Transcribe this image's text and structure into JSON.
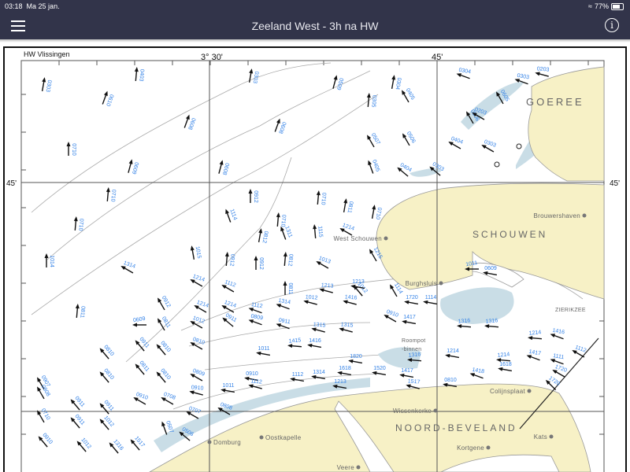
{
  "status_bar": {
    "time": "03:18",
    "date": "Ma 25 jan.",
    "battery": "77%",
    "battery_level": 0.77
  },
  "nav": {
    "title": "Zeeland West - 3h na HW",
    "menu_icon": "hamburger-icon",
    "info_icon": "info-icon",
    "info_glyph": "i"
  },
  "chart": {
    "reference": "HW  Vlissingen",
    "lon_labels": [
      "3° 30'",
      "45'"
    ],
    "lat_labels": [
      "45'",
      "45'"
    ],
    "places": [
      {
        "name": "GOEREE",
        "type": "region"
      },
      {
        "name": "Brouwershaven",
        "type": "town"
      },
      {
        "name": "West Schouwen",
        "type": "town"
      },
      {
        "name": "SCHOUWEN",
        "type": "region"
      },
      {
        "name": "Burghsluis",
        "type": "town"
      },
      {
        "name": "ZIERIKZEE",
        "type": "town"
      },
      {
        "name": "Roompot",
        "type": "label"
      },
      {
        "name": "-binnen",
        "type": "label"
      },
      {
        "name": "Colijnsplaat",
        "type": "town"
      },
      {
        "name": "Wissenkerke",
        "type": "town"
      },
      {
        "name": "NOORD-BEVELAND",
        "type": "region"
      },
      {
        "name": "Kats",
        "type": "town"
      },
      {
        "name": "Kortgene",
        "type": "town"
      },
      {
        "name": "Domburg",
        "type": "town"
      },
      {
        "name": "Oostkapelle",
        "type": "town"
      },
      {
        "name": "Veere",
        "type": "town"
      }
    ],
    "currents": [
      {
        "label": "0303",
        "bearing": 10
      },
      {
        "label": "0403",
        "bearing": 5
      },
      {
        "label": "0303",
        "bearing": 10
      },
      {
        "label": "0610",
        "bearing": 20
      },
      {
        "label": "0509",
        "bearing": 15
      },
      {
        "label": "0305",
        "bearing": 5
      },
      {
        "label": "0304",
        "bearing": 10
      },
      {
        "label": "0304",
        "bearing": 290
      },
      {
        "label": "0303",
        "bearing": 290
      },
      {
        "label": "0203",
        "bearing": 285
      },
      {
        "label": "0405",
        "bearing": 330
      },
      {
        "label": "0605",
        "bearing": 330
      },
      {
        "label": "0506",
        "bearing": 330
      },
      {
        "label": "0203",
        "bearing": 300
      },
      {
        "label": "0710",
        "bearing": 0
      },
      {
        "label": "0609",
        "bearing": 15
      },
      {
        "label": "0608",
        "bearing": 20
      },
      {
        "label": "0608",
        "bearing": 20
      },
      {
        "label": "0507",
        "bearing": 330
      },
      {
        "label": "0506",
        "bearing": 330
      },
      {
        "label": "0404",
        "bearing": 300
      },
      {
        "label": "0303",
        "bearing": 300
      },
      {
        "label": "0710",
        "bearing": 5
      },
      {
        "label": "0608",
        "bearing": 15
      },
      {
        "label": "0405",
        "bearing": 340
      },
      {
        "label": "0404",
        "bearing": 310
      },
      {
        "label": "0303",
        "bearing": 310
      },
      {
        "label": "0710",
        "bearing": 5
      },
      {
        "label": "1114",
        "bearing": 340
      },
      {
        "label": "0912",
        "bearing": 0
      },
      {
        "label": "0710",
        "bearing": 5
      },
      {
        "label": "0811",
        "bearing": 10
      },
      {
        "label": "0710",
        "bearing": 10
      },
      {
        "label": "0812",
        "bearing": 10
      },
      {
        "label": "0710",
        "bearing": 5
      },
      {
        "label": "1311",
        "bearing": 340
      },
      {
        "label": "1115",
        "bearing": 355
      },
      {
        "label": "1015",
        "bearing": 350
      },
      {
        "label": "0912",
        "bearing": 5
      },
      {
        "label": "0912",
        "bearing": 0
      },
      {
        "label": "0812",
        "bearing": 5
      },
      {
        "label": "1013",
        "bearing": 300
      },
      {
        "label": "1214",
        "bearing": 300
      },
      {
        "label": "1215",
        "bearing": 330
      },
      {
        "label": "1114",
        "bearing": 330
      },
      {
        "label": "1012",
        "bearing": 320
      },
      {
        "label": "0811",
        "bearing": 0
      },
      {
        "label": "1014",
        "bearing": 0
      },
      {
        "label": "1314",
        "bearing": 300
      },
      {
        "label": "1214",
        "bearing": 300
      },
      {
        "label": "1112",
        "bearing": 300
      },
      {
        "label": "1213",
        "bearing": 285
      },
      {
        "label": "1213",
        "bearing": 280
      },
      {
        "label": "0811",
        "bearing": 5
      },
      {
        "label": "0912",
        "bearing": 330
      },
      {
        "label": "1214",
        "bearing": 300
      },
      {
        "label": "1214",
        "bearing": 300
      },
      {
        "label": "1112",
        "bearing": 290
      },
      {
        "label": "1314",
        "bearing": 290
      },
      {
        "label": "1012",
        "bearing": 285
      },
      {
        "label": "1416",
        "bearing": 285
      },
      {
        "label": "1720",
        "bearing": 280
      },
      {
        "label": "1114",
        "bearing": 280
      },
      {
        "label": "1011",
        "bearing": 270
      },
      {
        "label": "0609",
        "bearing": 280
      },
      {
        "label": "0609",
        "bearing": 270
      },
      {
        "label": "0811",
        "bearing": 330
      },
      {
        "label": "1012",
        "bearing": 300
      },
      {
        "label": "0911",
        "bearing": 310
      },
      {
        "label": "0809",
        "bearing": 290
      },
      {
        "label": "0911",
        "bearing": 290
      },
      {
        "label": "1315",
        "bearing": 285
      },
      {
        "label": "1315",
        "bearing": 285
      },
      {
        "label": "0910",
        "bearing": 300
      },
      {
        "label": "1417",
        "bearing": 280
      },
      {
        "label": "1316",
        "bearing": 275
      },
      {
        "label": "1316",
        "bearing": 275
      },
      {
        "label": "1214",
        "bearing": 275
      },
      {
        "label": "1416",
        "bearing": 290
      },
      {
        "label": "1112",
        "bearing": 300
      },
      {
        "label": "0810",
        "bearing": 320
      },
      {
        "label": "0911",
        "bearing": 320
      },
      {
        "label": "0810",
        "bearing": 320
      },
      {
        "label": "0810",
        "bearing": 300
      },
      {
        "label": "1011",
        "bearing": 280
      },
      {
        "label": "1415",
        "bearing": 275
      },
      {
        "label": "1416",
        "bearing": 280
      },
      {
        "label": "1820",
        "bearing": 280
      },
      {
        "label": "1316",
        "bearing": 275
      },
      {
        "label": "1214",
        "bearing": 280
      },
      {
        "label": "1214",
        "bearing": 275
      },
      {
        "label": "1417",
        "bearing": 290
      },
      {
        "label": "1111",
        "bearing": 290
      },
      {
        "label": "0907",
        "bearing": 330
      },
      {
        "label": "0810",
        "bearing": 320
      },
      {
        "label": "0811",
        "bearing": 320
      },
      {
        "label": "0810",
        "bearing": 320
      },
      {
        "label": "0809",
        "bearing": 300
      },
      {
        "label": "0910",
        "bearing": 280
      },
      {
        "label": "1112",
        "bearing": 280
      },
      {
        "label": "1314",
        "bearing": 280
      },
      {
        "label": "1618",
        "bearing": 280
      },
      {
        "label": "1520",
        "bearing": 280
      },
      {
        "label": "1417",
        "bearing": 280
      },
      {
        "label": "1418",
        "bearing": 290
      },
      {
        "label": "1618",
        "bearing": 280
      },
      {
        "label": "1720",
        "bearing": 300
      },
      {
        "label": "0808",
        "bearing": 330
      },
      {
        "label": "0911",
        "bearing": 320
      },
      {
        "label": "0911",
        "bearing": 320
      },
      {
        "label": "0910",
        "bearing": 300
      },
      {
        "label": "0708",
        "bearing": 300
      },
      {
        "label": "0910",
        "bearing": 285
      },
      {
        "label": "1011",
        "bearing": 280
      },
      {
        "label": "1112",
        "bearing": 285
      },
      {
        "label": "1213",
        "bearing": 280
      },
      {
        "label": "1517",
        "bearing": 285
      },
      {
        "label": "0810",
        "bearing": 280
      },
      {
        "label": "1720",
        "bearing": 315
      },
      {
        "label": "0710",
        "bearing": 330
      },
      {
        "label": "0911",
        "bearing": 320
      },
      {
        "label": "1012",
        "bearing": 320
      },
      {
        "label": "0707",
        "bearing": 300
      },
      {
        "label": "0808",
        "bearing": 300
      },
      {
        "label": "0506",
        "bearing": 310
      },
      {
        "label": "0507",
        "bearing": 340
      },
      {
        "label": "0910",
        "bearing": 320
      },
      {
        "label": "1012",
        "bearing": 320
      },
      {
        "label": "1316",
        "bearing": 320
      },
      {
        "label": "1517",
        "bearing": 320
      }
    ]
  }
}
